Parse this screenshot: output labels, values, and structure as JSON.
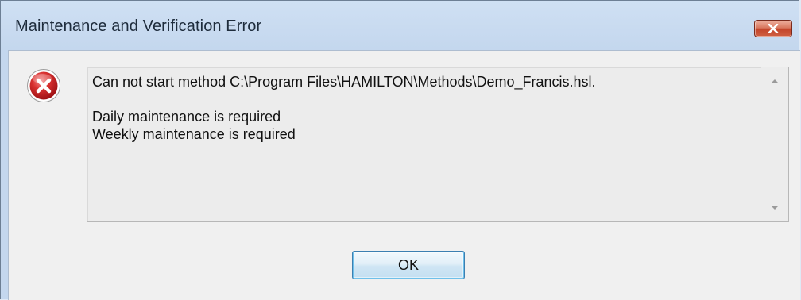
{
  "window": {
    "title": "Maintenance and Verification Error",
    "close_icon": "close-x-icon"
  },
  "dialog": {
    "icon": "error-icon",
    "message_lines": [
      "Can not start method C:\\Program Files\\HAMILTON\\Methods\\Demo_Francis.hsl.",
      "",
      "Daily maintenance is required",
      "Weekly maintenance is required"
    ],
    "scroll_up_icon": "scroll-up-arrow-icon",
    "scroll_down_icon": "scroll-down-arrow-icon",
    "ok_label": "OK"
  },
  "colors": {
    "close_button": "#c4462b",
    "error_icon_red": "#c8242b",
    "ok_button_border": "#3c7fb1"
  }
}
